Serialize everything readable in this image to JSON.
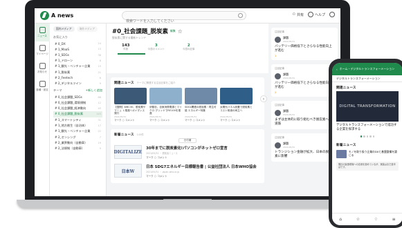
{
  "app": {
    "name": "A news"
  },
  "header": {
    "search_placeholder": "検索ワードを入力してください",
    "shared_label": "共有",
    "help_label": "ヘルプ"
  },
  "rail": {
    "items": [
      {
        "label": "ニュース",
        "active": true
      },
      {
        "label": "マイページ",
        "active": false
      },
      {
        "label": "お知らせ",
        "active": false
      },
      {
        "label": "各種・設定",
        "active": false
      }
    ]
  },
  "sidebar": {
    "tabs": [
      {
        "label": "国内メディア"
      },
      {
        "label": "海外メディア"
      }
    ],
    "favorites_heading": "お気に入り",
    "favorites": [
      {
        "label": "# 0_DX",
        "count": "24"
      },
      {
        "label": "# 1_MaaS",
        "count": "13"
      },
      {
        "label": "# 1_SDGs",
        "count": "38"
      },
      {
        "label": "# 1_ドローン",
        "count": "8"
      },
      {
        "label": "# 1_観光・ベンチャー企業",
        "count": "15"
      },
      {
        "label": "# 1_脱炭素",
        "count": "21"
      },
      {
        "label": "# 2_Feetech",
        "count": "6"
      },
      {
        "label": "# 2_デジタルツイン",
        "count": "9"
      }
    ],
    "themes_heading": "テーマ",
    "add_label": "+新しく追加",
    "themes": [
      {
        "label": "# 0_社会課題_SDGs",
        "count": "88",
        "selected": false
      },
      {
        "label": "# 0_社会課題_環境規制",
        "count": "12",
        "selected": false
      },
      {
        "label": "# 0_社会課題_経済動向",
        "count": "45",
        "selected": false
      },
      {
        "label": "# 0_社会課題_脱炭素",
        "count": "143",
        "selected": true
      },
      {
        "label": "# 1_スマートシティ",
        "count": "31",
        "selected": false
      },
      {
        "label": "# 1_地方創生（自治体）",
        "count": "17",
        "selected": false
      },
      {
        "label": "# 1_観光・ベンチャー企業",
        "count": "22",
        "selected": false
      },
      {
        "label": "# 2_センシング",
        "count": "7",
        "selected": false
      },
      {
        "label": "# 2_業界動向（自動車）",
        "count": "19",
        "selected": false
      },
      {
        "label": "# 2_法規制（自動車）",
        "count": "5",
        "selected": false
      }
    ]
  },
  "main": {
    "title": "#0_社会課題_脱炭素",
    "title_tag": "編集",
    "subtitle": "脱炭素に関する最新トレンド",
    "stats": [
      {
        "value": "143",
        "label": "件数"
      },
      {
        "value": "3",
        "label": "今週のコメント"
      },
      {
        "value": "2",
        "label": "今週の記事"
      }
    ],
    "related": {
      "heading": "関連ニュース",
      "hint": "テーマに関連する注目記事をご紹介",
      "items": [
        {
          "caption": "【国際】WBC30、脱炭素やマニュ ト推進へガイダンス発行",
          "source": "2021/05/31",
          "action": "マーク ○ コメント",
          "color": "#3c5a78"
        },
        {
          "caption": "伊藤忠、自家消費電源とマイクロ グリッドでRE100を推進",
          "source": "2021/05/31",
          "action": "マーク ○ コメント",
          "color": "#8fb0cc"
        },
        {
          "caption": "SDGs関連の脱炭素・再生可能 エネルギー特集",
          "source": "2021/05/31",
          "action": "マーク ○ コメント",
          "color": "#6f8aa8"
        },
        {
          "caption": "太陽光パネル設置で脱炭素と コスト削減の両立へ",
          "source": "2021/05/31",
          "action": "マーク ○ コメント",
          "color": "#2f5f88"
        }
      ]
    },
    "new_news": {
      "heading": "新着ニュース",
      "count": "143件",
      "sort": "日付順",
      "items": [
        {
          "logo": "DIGITALIZE",
          "title": "30年までに脱炭素化!パソコンがネットゼロ宣言",
          "meta": "2021/05/31 ・ 脱炭素ニュース",
          "action": "マーク ○ コメント"
        },
        {
          "logo": "日本W",
          "title": "日本 SDG7エネルギー目標報告書 | 公益社団法人 日本WHO協会",
          "meta": "2021/05/31 ・ japan-who.or.jp",
          "action": "マーク ○ コメント"
        }
      ]
    }
  },
  "right": {
    "cards": [
      {
        "type": "注目記事",
        "user": "課題",
        "date": "2021/05/31",
        "body": "バッテリー価格低下とさらなる性能向上が進む",
        "likes": "1"
      },
      {
        "type": "注目記事",
        "user": "課題",
        "date": "2021/05/31",
        "body": "バッテリー価格低下とさらなる性能向上が進む",
        "likes": "2"
      },
      {
        "type": "注目記事",
        "user": "課題",
        "date": "2021/05/31",
        "body": "まずは主体的に取り組むべき脱炭素への道筋",
        "likes": ""
      },
      {
        "type": "注目記事",
        "user": "課題",
        "date": "2021/05/31",
        "body": "トランジション金融が拡大、日本の脱炭素に影響",
        "likes": ""
      }
    ]
  },
  "phone": {
    "bar_title": "ホーム・デジタルトランスフォーメーション",
    "tab": "デジタルトランスフォーメーション",
    "related_heading": "関連ニュース",
    "hero_text": "DIGITAL TRANSFORMATION",
    "hero_caption": "デジタルトランスフォーメーションで成功する企業を探求する",
    "new_heading": "新着ニュース",
    "item_title": "モノを取り扱う企業のDXと基盤整備を論じる",
    "comment": "御社の製造現場への応用を進めているが、実装はまだ道半ばです。"
  },
  "colors": {
    "accent": "#1f8a4c",
    "frame": "#1e1f22"
  }
}
